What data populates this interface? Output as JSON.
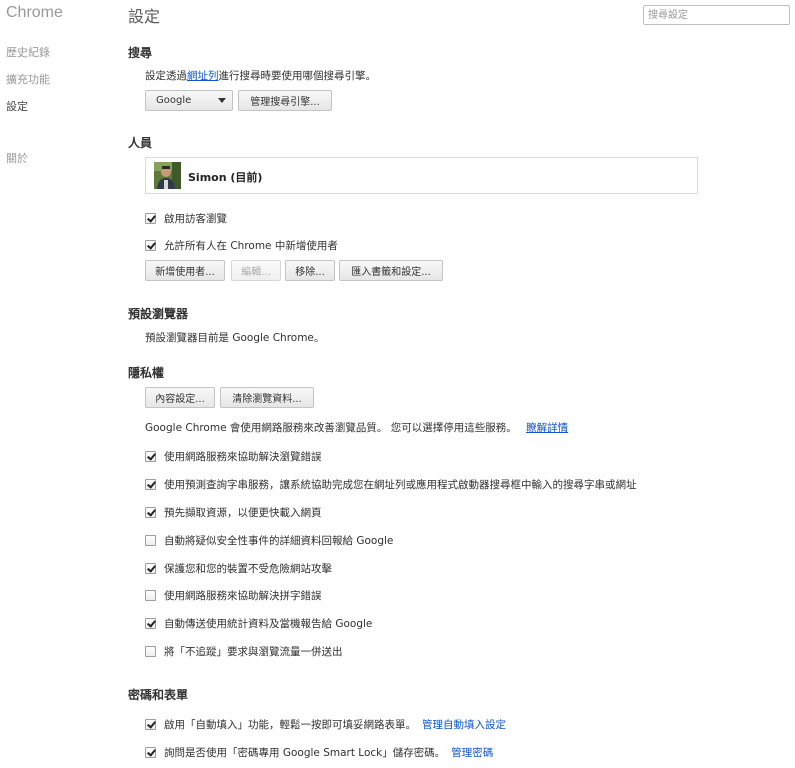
{
  "sidebar": {
    "brand": "Chrome",
    "items": [
      {
        "label": "歷史紀錄"
      },
      {
        "label": "擴充功能"
      },
      {
        "label": "設定",
        "selected": true
      },
      {
        "label": "關於"
      }
    ]
  },
  "header": {
    "title": "設定",
    "search_placeholder": "搜尋設定"
  },
  "search_section": {
    "title": "搜尋",
    "desc_prefix": "設定透過",
    "desc_link": "網址列",
    "desc_suffix": "進行搜尋時要使用哪個搜尋引擎。",
    "engine_selected": "Google",
    "manage_button": "管理搜尋引擎..."
  },
  "people": {
    "title": "人員",
    "profile_name": "Simon (目前)",
    "guest_browsing": {
      "label": "啟用訪客瀏覽",
      "checked": true
    },
    "allow_add": {
      "label": "允許所有人在 Chrome 中新增使用者",
      "checked": true
    },
    "buttons": {
      "add": "新增使用者...",
      "edit": "編輯...",
      "remove": "移除...",
      "import": "匯入書籤和設定..."
    }
  },
  "default_browser": {
    "title": "預設瀏覽器",
    "text": "預設瀏覽器目前是 Google Chrome。"
  },
  "privacy": {
    "title": "隱私權",
    "content_settings_button": "內容設定...",
    "clear_data_button": "清除瀏覽資料...",
    "desc": "Google Chrome 會使用網路服務來改善瀏覽品質。 您可以選擇停用這些服務。",
    "learn_more": "瞭解詳情",
    "options": [
      {
        "label": "使用網路服務來協助解決瀏覽錯誤",
        "checked": true
      },
      {
        "label": "使用預測查詢字串服務，讓系統協助完成您在網址列或應用程式啟動器搜尋框中輸入的搜尋字串或網址",
        "checked": true
      },
      {
        "label": "預先擷取資源，以便更快載入網頁",
        "checked": true
      },
      {
        "label": "自動將疑似安全性事件的詳細資料回報給 Google",
        "checked": false
      },
      {
        "label": "保護您和您的裝置不受危險網站攻擊",
        "checked": true
      },
      {
        "label": "使用網路服務來協助解決拼字錯誤",
        "checked": false
      },
      {
        "label": "自動傳送使用統計資料及當機報告給 Google",
        "checked": true
      },
      {
        "label": "將「不追蹤」要求與瀏覽流量一併送出",
        "checked": false
      }
    ]
  },
  "passwords": {
    "title": "密碼和表單",
    "autofill": {
      "label": "啟用「自動填入」功能，輕鬆一按即可填妥網路表單。",
      "link": "管理自動填入設定",
      "checked": true
    },
    "smart_lock": {
      "label": "詢問是否使用「密碼專用 Google Smart Lock」儲存密碼。",
      "link": "管理密碼",
      "checked": true
    }
  }
}
